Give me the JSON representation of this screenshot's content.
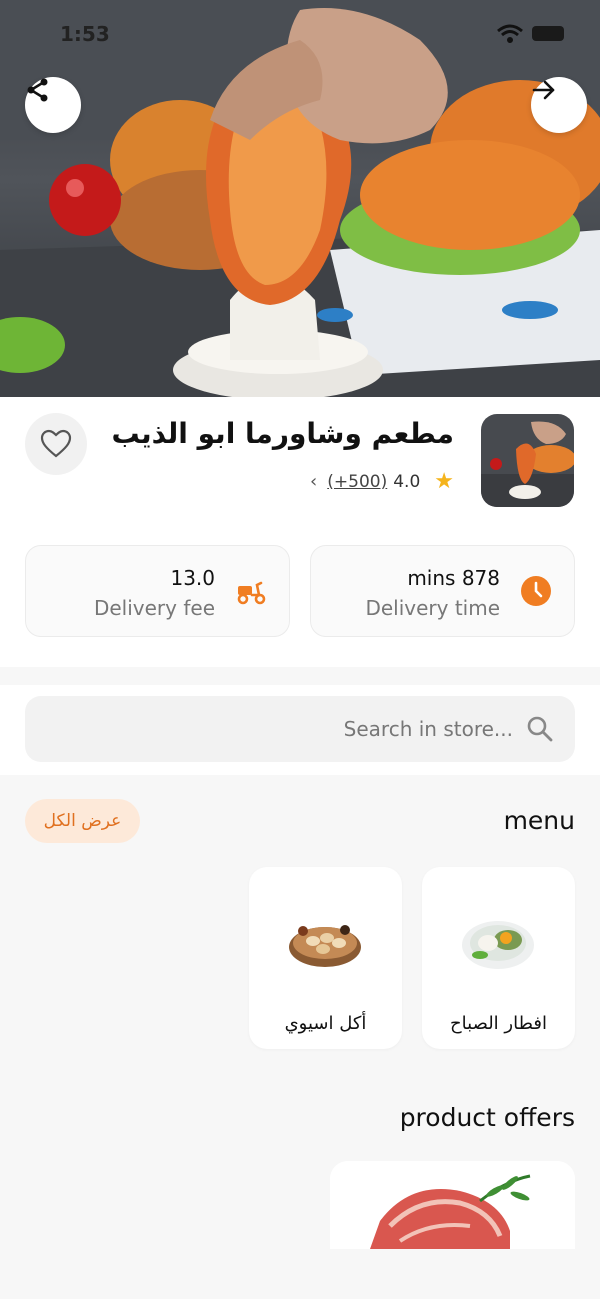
{
  "status_bar": {
    "time": "1:53"
  },
  "hero": {
    "share_icon": "share-icon",
    "next_icon": "arrow-right-icon"
  },
  "restaurant": {
    "name": "مطعم وشاورما ابو الذيب",
    "rating": "4.0",
    "reviews": "(+500)",
    "favorite_icon": "heart-icon"
  },
  "stats": {
    "delivery_time": {
      "value": "mins 878",
      "label": "Delivery time",
      "icon": "clock-icon"
    },
    "delivery_fee": {
      "value": "13.0",
      "label": "Delivery fee",
      "icon": "scooter-icon"
    }
  },
  "search": {
    "placeholder": "Search in store..."
  },
  "menu": {
    "title": "menu",
    "view_all": "عرض الكل",
    "categories": [
      {
        "label": "افطار الصباح"
      },
      {
        "label": "أكل اسيوي"
      }
    ]
  },
  "offers": {
    "title": "product offers"
  },
  "colors": {
    "accent": "#f07d22",
    "star": "#f5b41c"
  }
}
